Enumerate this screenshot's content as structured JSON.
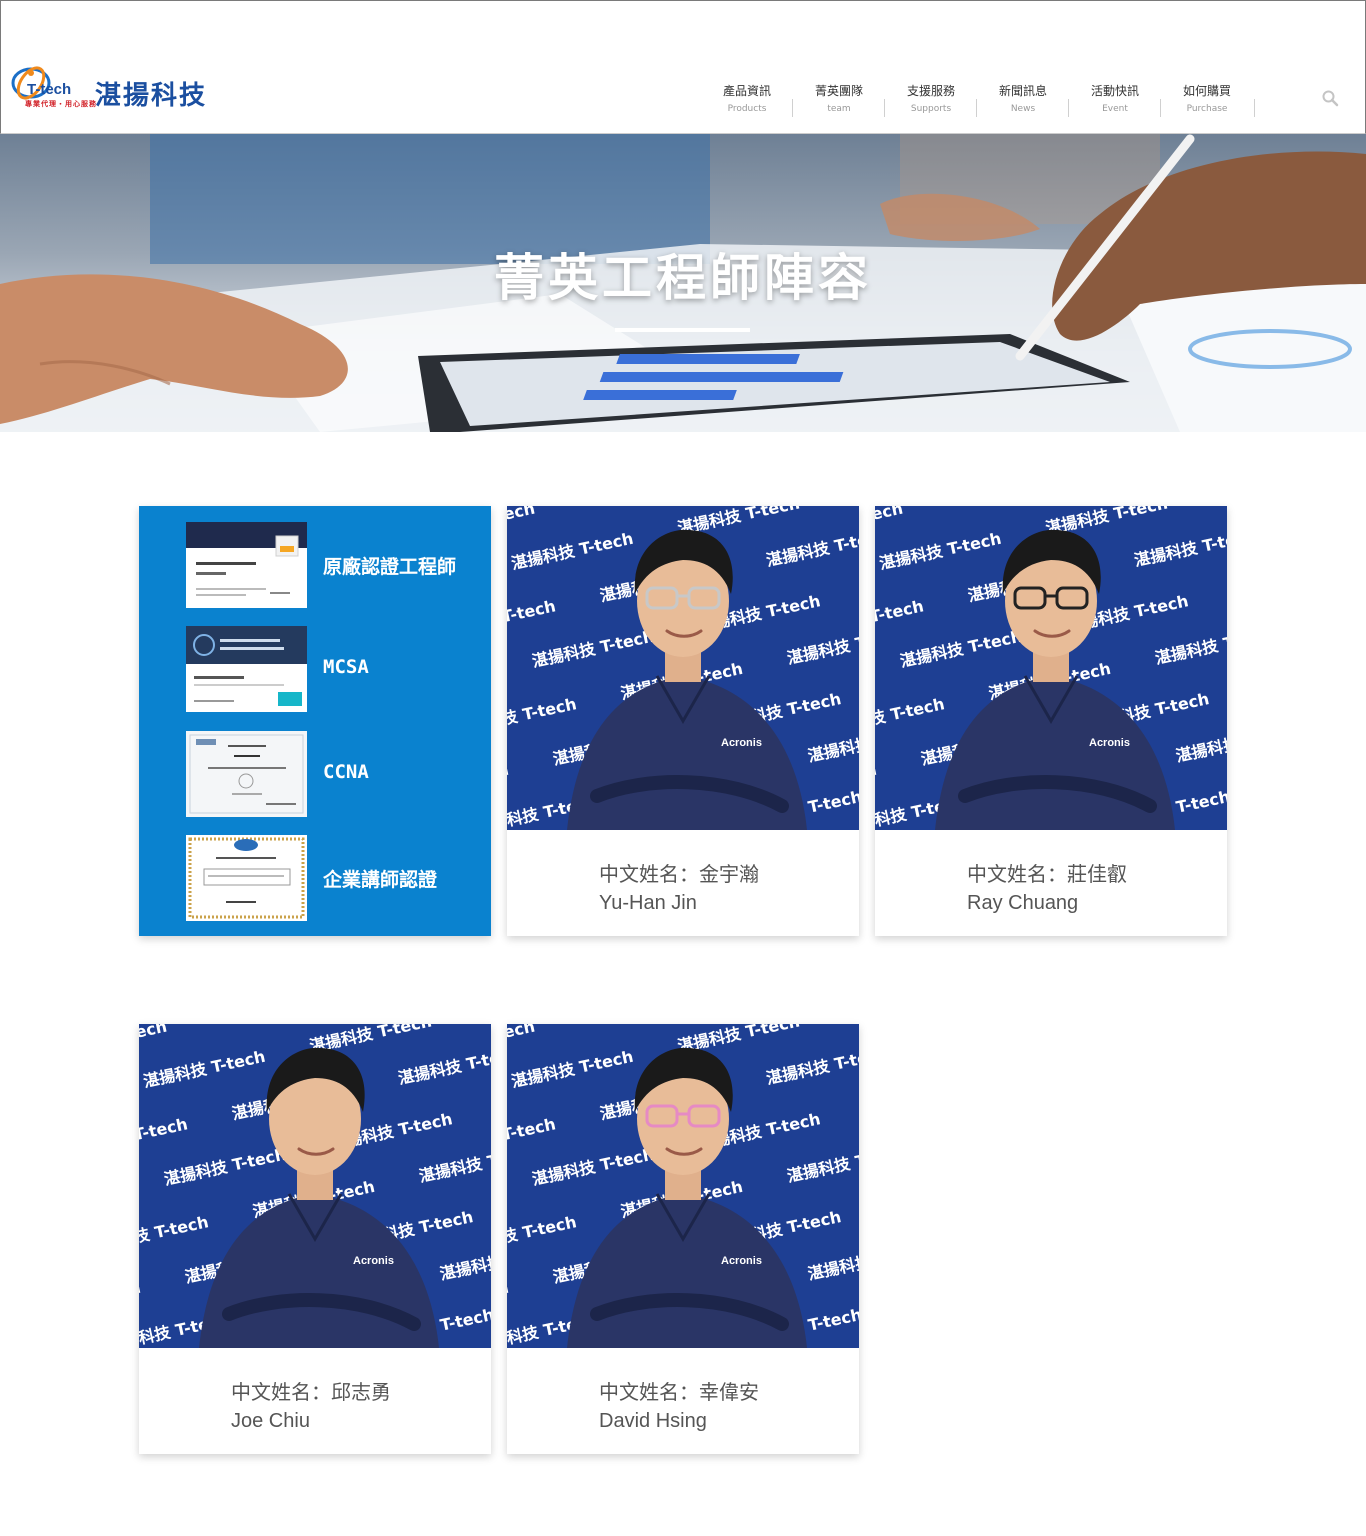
{
  "brand": {
    "name": "湛揚科技",
    "emblem_text": "T-tech",
    "tagline": "專業代理・用心服務"
  },
  "nav": [
    {
      "zh": "產品資訊",
      "en": "Products"
    },
    {
      "zh": "菁英團隊",
      "en": "team"
    },
    {
      "zh": "支援服務",
      "en": "Supports"
    },
    {
      "zh": "新聞訊息",
      "en": "News"
    },
    {
      "zh": "活動快訊",
      "en": "Event"
    },
    {
      "zh": "如何購買",
      "en": "Purchase"
    }
  ],
  "search": {
    "icon": "search-icon"
  },
  "banner": {
    "title": "菁英工程師陣容"
  },
  "certifications": [
    {
      "label": "原廠認證工程師",
      "thumb": "acronis-certificate"
    },
    {
      "label": "MCSA",
      "thumb": "microsoft-certificate"
    },
    {
      "label": "CCNA",
      "thumb": "cisco-certificate"
    },
    {
      "label": "企業講師認證",
      "thumb": "instructor-certificate"
    }
  ],
  "photo_backdrop_text": "湛揚科技 T-tech",
  "shirt_logo": "Acronis",
  "engineers": [
    {
      "name_zh": "中文姓名：金宇瀚",
      "name_en": "Yu-Han Jin",
      "glasses": "#c8c8c8"
    },
    {
      "name_zh": "中文姓名：莊佳叡",
      "name_en": "Ray Chuang",
      "glasses": "#222222"
    },
    {
      "name_zh": "中文姓名：邱志勇",
      "name_en": "Joe Chiu",
      "glasses": ""
    },
    {
      "name_zh": "中文姓名：幸偉安",
      "name_en": "David Hsing",
      "glasses": "#e68ac4"
    }
  ],
  "colors": {
    "brand_blue": "#1b4fa0",
    "cert_blue": "#0a82cf",
    "backdrop_blue": "#1e3f93",
    "shirt_navy": "#2a3566"
  }
}
